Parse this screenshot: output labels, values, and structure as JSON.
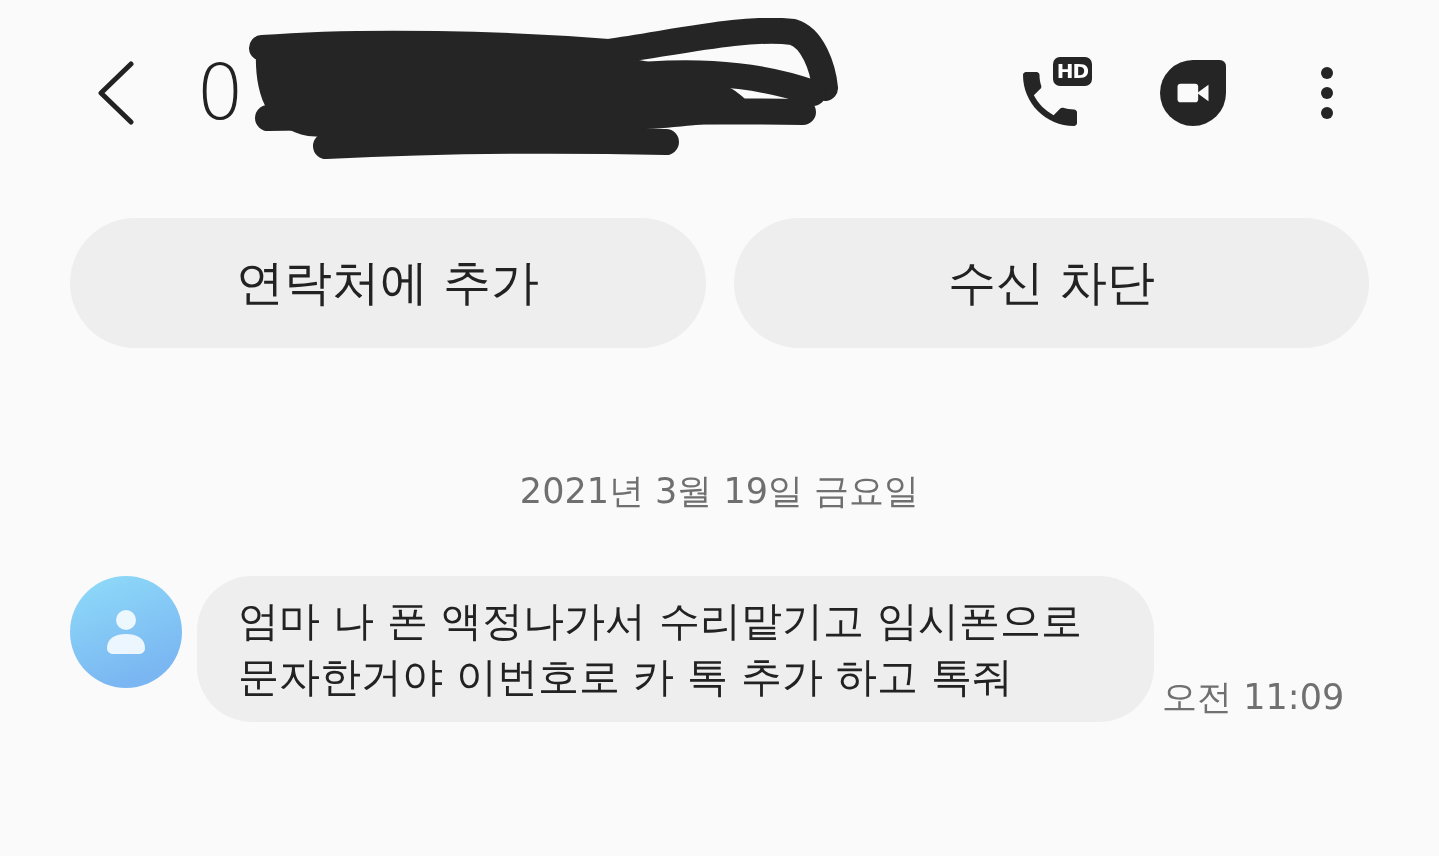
{
  "header": {
    "title": "0",
    "redacted": true,
    "actions": [
      {
        "kind": "hd_call",
        "badge": "HD"
      },
      {
        "kind": "video_call"
      },
      {
        "kind": "more"
      }
    ]
  },
  "contact_buttons": [
    "연락처에 추가",
    "수신 차단"
  ],
  "date_divider": "2021년 3월 19일 금요일",
  "messages": [
    {
      "kind": "incoming",
      "text": "엄마 나 폰 액정나가서 수리맡기고 임시폰으로\n문자한거야 이번호로 카 톡 추가 하고 톡줘",
      "time": "오전 11:09"
    }
  ]
}
